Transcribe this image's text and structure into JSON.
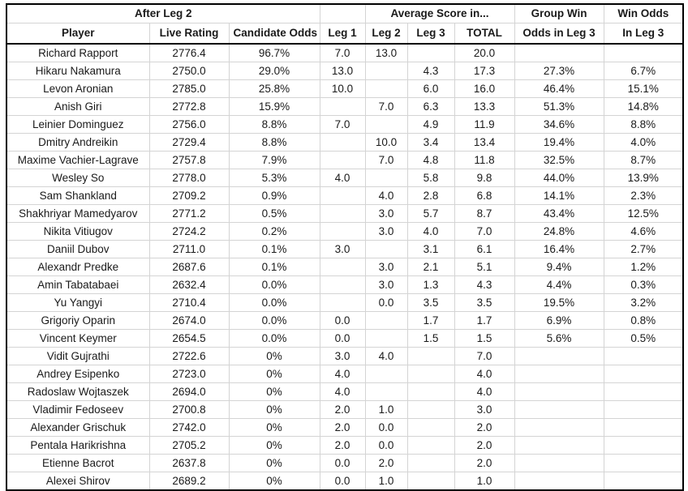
{
  "table": {
    "group_headers": [
      {
        "label": "",
        "span": 0,
        "blank": true
      },
      {
        "label": "After Leg 2",
        "span": 3
      },
      {
        "label": "",
        "span": 1,
        "blank": true
      },
      {
        "label": "Average Score in...",
        "span": 3
      },
      {
        "label": "Group Win",
        "span": 1
      },
      {
        "label": "Win Odds",
        "span": 1
      }
    ],
    "columns": [
      "Player",
      "Live Rating",
      "Candidate Odds",
      "Leg 1",
      "Leg 2",
      "Leg 3",
      "TOTAL",
      "Odds in Leg 3",
      "In Leg 3"
    ],
    "rows": [
      [
        "Richard Rapport",
        "2776.4",
        "96.7%",
        "7.0",
        "13.0",
        "",
        "20.0",
        "",
        ""
      ],
      [
        "Hikaru Nakamura",
        "2750.0",
        "29.0%",
        "13.0",
        "",
        "4.3",
        "17.3",
        "27.3%",
        "6.7%"
      ],
      [
        "Levon Aronian",
        "2785.0",
        "25.8%",
        "10.0",
        "",
        "6.0",
        "16.0",
        "46.4%",
        "15.1%"
      ],
      [
        "Anish Giri",
        "2772.8",
        "15.9%",
        "",
        "7.0",
        "6.3",
        "13.3",
        "51.3%",
        "14.8%"
      ],
      [
        "Leinier Dominguez",
        "2756.0",
        "8.8%",
        "7.0",
        "",
        "4.9",
        "11.9",
        "34.6%",
        "8.8%"
      ],
      [
        "Dmitry Andreikin",
        "2729.4",
        "8.8%",
        "",
        "10.0",
        "3.4",
        "13.4",
        "19.4%",
        "4.0%"
      ],
      [
        "Maxime Vachier-Lagrave",
        "2757.8",
        "7.9%",
        "",
        "7.0",
        "4.8",
        "11.8",
        "32.5%",
        "8.7%"
      ],
      [
        "Wesley So",
        "2778.0",
        "5.3%",
        "4.0",
        "",
        "5.8",
        "9.8",
        "44.0%",
        "13.9%"
      ],
      [
        "Sam Shankland",
        "2709.2",
        "0.9%",
        "",
        "4.0",
        "2.8",
        "6.8",
        "14.1%",
        "2.3%"
      ],
      [
        "Shakhriyar Mamedyarov",
        "2771.2",
        "0.5%",
        "",
        "3.0",
        "5.7",
        "8.7",
        "43.4%",
        "12.5%"
      ],
      [
        "Nikita Vitiugov",
        "2724.2",
        "0.2%",
        "",
        "3.0",
        "4.0",
        "7.0",
        "24.8%",
        "4.6%"
      ],
      [
        "Daniil Dubov",
        "2711.0",
        "0.1%",
        "3.0",
        "",
        "3.1",
        "6.1",
        "16.4%",
        "2.7%"
      ],
      [
        "Alexandr Predke",
        "2687.6",
        "0.1%",
        "",
        "3.0",
        "2.1",
        "5.1",
        "9.4%",
        "1.2%"
      ],
      [
        "Amin Tabatabaei",
        "2632.4",
        "0.0%",
        "",
        "3.0",
        "1.3",
        "4.3",
        "4.4%",
        "0.3%"
      ],
      [
        "Yu Yangyi",
        "2710.4",
        "0.0%",
        "",
        "0.0",
        "3.5",
        "3.5",
        "19.5%",
        "3.2%"
      ],
      [
        "Grigoriy Oparin",
        "2674.0",
        "0.0%",
        "0.0",
        "",
        "1.7",
        "1.7",
        "6.9%",
        "0.8%"
      ],
      [
        "Vincent Keymer",
        "2654.5",
        "0.0%",
        "0.0",
        "",
        "1.5",
        "1.5",
        "5.6%",
        "0.5%"
      ],
      [
        "Vidit Gujrathi",
        "2722.6",
        "0%",
        "3.0",
        "4.0",
        "",
        "7.0",
        "",
        ""
      ],
      [
        "Andrey Esipenko",
        "2723.0",
        "0%",
        "4.0",
        "",
        "",
        "4.0",
        "",
        ""
      ],
      [
        "Radoslaw Wojtaszek",
        "2694.0",
        "0%",
        "4.0",
        "",
        "",
        "4.0",
        "",
        ""
      ],
      [
        "Vladimir Fedoseev",
        "2700.8",
        "0%",
        "2.0",
        "1.0",
        "",
        "3.0",
        "",
        ""
      ],
      [
        "Alexander Grischuk",
        "2742.0",
        "0%",
        "2.0",
        "0.0",
        "",
        "2.0",
        "",
        ""
      ],
      [
        "Pentala Harikrishna",
        "2705.2",
        "0%",
        "2.0",
        "0.0",
        "",
        "2.0",
        "",
        ""
      ],
      [
        "Etienne Bacrot",
        "2637.8",
        "0%",
        "0.0",
        "2.0",
        "",
        "2.0",
        "",
        ""
      ],
      [
        "Alexei Shirov",
        "2689.2",
        "0%",
        "0.0",
        "1.0",
        "",
        "1.0",
        "",
        ""
      ]
    ]
  }
}
